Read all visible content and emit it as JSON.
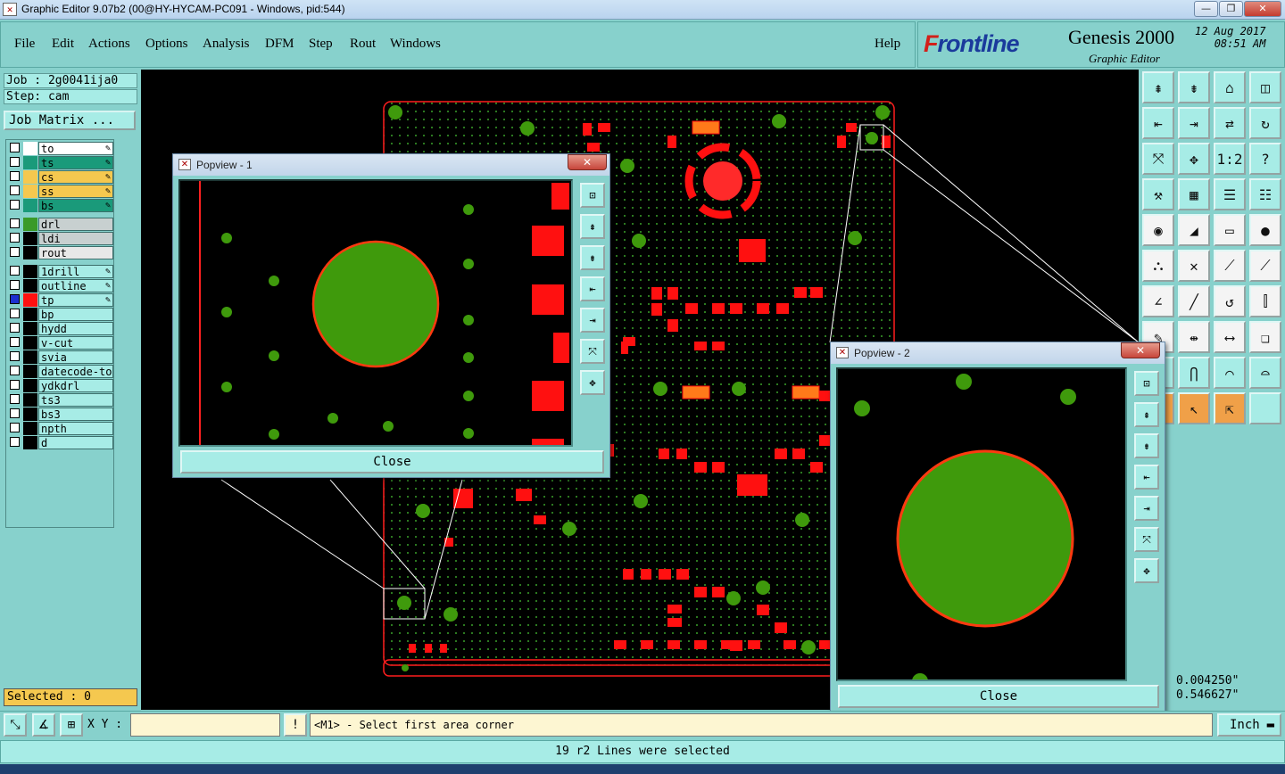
{
  "window": {
    "title": "Graphic Editor 9.07b2 (00@HY-HYCAM-PC091 - Windows, pid:544)",
    "minimize": "—",
    "restore": "❐",
    "close": "✕"
  },
  "menu": {
    "items": [
      {
        "label": "File"
      },
      {
        "label": "Edit"
      },
      {
        "label": "Actions"
      },
      {
        "label": "Options"
      },
      {
        "label": "Analysis"
      },
      {
        "label": "DFM"
      },
      {
        "label": "Step"
      },
      {
        "label": "Rout"
      },
      {
        "label": "Windows"
      }
    ],
    "help": "Help"
  },
  "brand": {
    "logo_prefix": "F",
    "logo_rest": "rontline",
    "product": "Genesis 2000",
    "subtitle": "Graphic Editor",
    "date": "12 Aug 2017",
    "time": "08:51 AM"
  },
  "left_panel": {
    "job": "Job : 2g0041ija0",
    "step": "Step: cam",
    "job_matrix": "Job Matrix ...",
    "selected": "Selected : 0"
  },
  "layers": [
    {
      "name": "to",
      "color": "#ffffff",
      "name_bg": "#ffffff",
      "editable": true,
      "active": false,
      "group": 0
    },
    {
      "name": "ts",
      "color": "#1a9a7a",
      "name_bg": "#1a9a7a",
      "editable": true,
      "active": false,
      "group": 0
    },
    {
      "name": "cs",
      "color": "#f5c84f",
      "name_bg": "#f5c84f",
      "editable": true,
      "active": false,
      "group": 0
    },
    {
      "name": "ss",
      "color": "#f5c84f",
      "name_bg": "#f5c84f",
      "editable": true,
      "active": false,
      "group": 0
    },
    {
      "name": "bs",
      "color": "#1a9a7a",
      "name_bg": "#1a9a7a",
      "editable": true,
      "active": false,
      "group": 0
    },
    {
      "name": "drl",
      "color": "#3a9a28",
      "name_bg": "#c8d0d0",
      "editable": false,
      "active": false,
      "group": 1
    },
    {
      "name": "ldi",
      "color": "#000000",
      "name_bg": "#c8d0d0",
      "editable": false,
      "active": false,
      "group": 1
    },
    {
      "name": "rout",
      "color": "#000000",
      "name_bg": "#e8e8e8",
      "editable": false,
      "active": false,
      "group": 1
    },
    {
      "name": "1drill",
      "color": "#000000",
      "name_bg": "#a7ece6",
      "editable": true,
      "active": false,
      "group": 2
    },
    {
      "name": "outline",
      "color": "#000000",
      "name_bg": "#a7ece6",
      "editable": true,
      "active": false,
      "group": 2
    },
    {
      "name": "tp",
      "color": "#ff1010",
      "name_bg": "#a7ece6",
      "editable": true,
      "active": true,
      "group": 2
    },
    {
      "name": "bp",
      "color": "#000000",
      "name_bg": "#a7ece6",
      "editable": false,
      "active": false,
      "group": 2
    },
    {
      "name": "hydd",
      "color": "#000000",
      "name_bg": "#a7ece6",
      "editable": false,
      "active": false,
      "group": 2
    },
    {
      "name": "v-cut",
      "color": "#000000",
      "name_bg": "#a7ece6",
      "editable": false,
      "active": false,
      "group": 2
    },
    {
      "name": "svia",
      "color": "#000000",
      "name_bg": "#a7ece6",
      "editable": false,
      "active": false,
      "group": 2
    },
    {
      "name": "datecode-to",
      "color": "#000000",
      "name_bg": "#a7ece6",
      "editable": false,
      "active": false,
      "group": 2
    },
    {
      "name": "ydkdrl",
      "color": "#000000",
      "name_bg": "#a7ece6",
      "editable": false,
      "active": false,
      "group": 2
    },
    {
      "name": "ts3",
      "color": "#000000",
      "name_bg": "#a7ece6",
      "editable": false,
      "active": false,
      "group": 2
    },
    {
      "name": "bs3",
      "color": "#000000",
      "name_bg": "#a7ece6",
      "editable": false,
      "active": false,
      "group": 2
    },
    {
      "name": "npth",
      "color": "#000000",
      "name_bg": "#a7ece6",
      "editable": false,
      "active": false,
      "group": 2
    },
    {
      "name": "d",
      "color": "#000000",
      "name_bg": "#a7ece6",
      "editable": false,
      "active": false,
      "group": 2
    }
  ],
  "toolbar_icons": [
    "page-up-icon",
    "page-down-icon",
    "home-icon",
    "split-view-icon",
    "pan-left-icon",
    "pan-right-icon",
    "swap-icon",
    "redraw-icon",
    "zoom-fit-icon",
    "zoom-center-icon",
    "scale-1-2-icon",
    "help-query-icon",
    "wrench-icon",
    "grid-icon",
    "layer-stack-icon",
    "layer-stack-active-icon",
    "pad-select-icon",
    "slope-icon",
    "ruler-icon",
    "circle-pad-icon",
    "connect-icon",
    "cross-icon",
    "line-node-icon",
    "line-node-alt-icon",
    "angle-icon",
    "diagonal-icon",
    "rotate-icon",
    "align-icon",
    "node-edit-icon",
    "move-icon",
    "measure-icon",
    "copy-icon",
    "arc-up-icon",
    "arc-wide-icon",
    "arc-flat-icon",
    "arc-dash-icon",
    "cursor-icon",
    "cursor-alt-icon",
    "cursor-multi-icon",
    "empty-icon"
  ],
  "coords": {
    "x": "0.004250\"",
    "y": "0.546627\""
  },
  "bottom": {
    "xy_label": "X Y :",
    "xy_value": "",
    "prompt": "<M1> - Select first area corner",
    "unit": "Inch"
  },
  "status": "19 r2 Lines were selected",
  "popview1": {
    "title": "Popview - 1",
    "close": "Close"
  },
  "popview2": {
    "title": "Popview - 2",
    "close": "Close"
  },
  "colors": {
    "board_outline": "#ff1e1e",
    "pad": "#3f9a0c",
    "copper": "#ff1010",
    "dots": "#3aa02a"
  }
}
